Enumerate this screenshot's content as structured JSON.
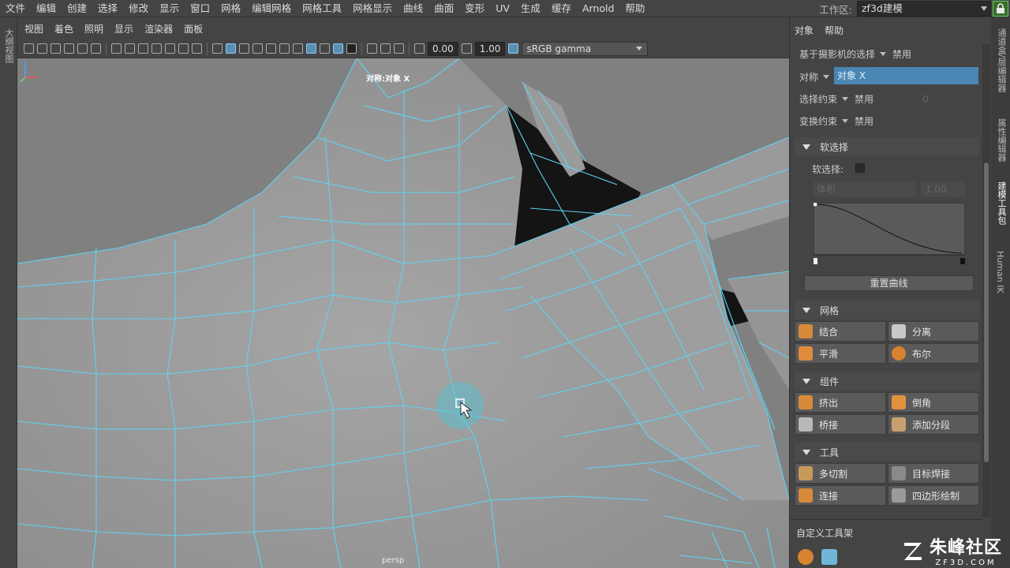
{
  "menubar": {
    "items": [
      "文件",
      "编辑",
      "创建",
      "选择",
      "修改",
      "显示",
      "窗口",
      "网格",
      "编辑网格",
      "网格工具",
      "网格显示",
      "曲线",
      "曲面",
      "变形",
      "UV",
      "生成",
      "缓存",
      "Arnold",
      "帮助"
    ]
  },
  "workspace": {
    "label": "工作区:",
    "value": "zf3d建模"
  },
  "left_strip": {
    "label": "大纲视图"
  },
  "panel_menu": {
    "items": [
      "视图",
      "着色",
      "照明",
      "显示",
      "渲染器",
      "面板"
    ]
  },
  "viewport_toolbar": {
    "exposure": "0.00",
    "gamma": "1.00",
    "colorspace": "sRGB gamma"
  },
  "viewport": {
    "symmetry_label": "对称:对象 X",
    "camera_label": "persp",
    "accent_color": "#5fd3f3"
  },
  "right_panel": {
    "menu": [
      "对象",
      "帮助"
    ],
    "camera_select_label": "基于摄影机的选择",
    "camera_select_value": "禁用",
    "symmetry_label": "对称",
    "symmetry_value": "对象 X",
    "select_constraint_label": "选择约束",
    "select_constraint_value": "禁用",
    "select_constraint_num": "0",
    "transform_constraint_label": "变换约束",
    "transform_constraint_value": "禁用",
    "soft_section": "软选择",
    "soft_checkbox_label": "软选择:",
    "falloff_mode": "体积",
    "falloff_radius": "1.00",
    "reset_curve": "重置曲线",
    "mesh_section": "网格",
    "mesh_buttons": [
      "结合",
      "分离",
      "平滑",
      "布尔"
    ],
    "component_section": "组件",
    "component_buttons": [
      "挤出",
      "倒角",
      "桥接",
      "添加分段"
    ],
    "tools_section": "工具",
    "tool_buttons": [
      "多切割",
      "目标焊接",
      "连接",
      "四边形绘制"
    ],
    "shelf_label": "自定义工具架"
  },
  "right_tabs": [
    "通道盒/层编辑器",
    "属性编辑器",
    "建模工具包",
    "Human IK"
  ],
  "watermark": {
    "cn": "朱峰社区",
    "en": "ZF3D.COM"
  }
}
